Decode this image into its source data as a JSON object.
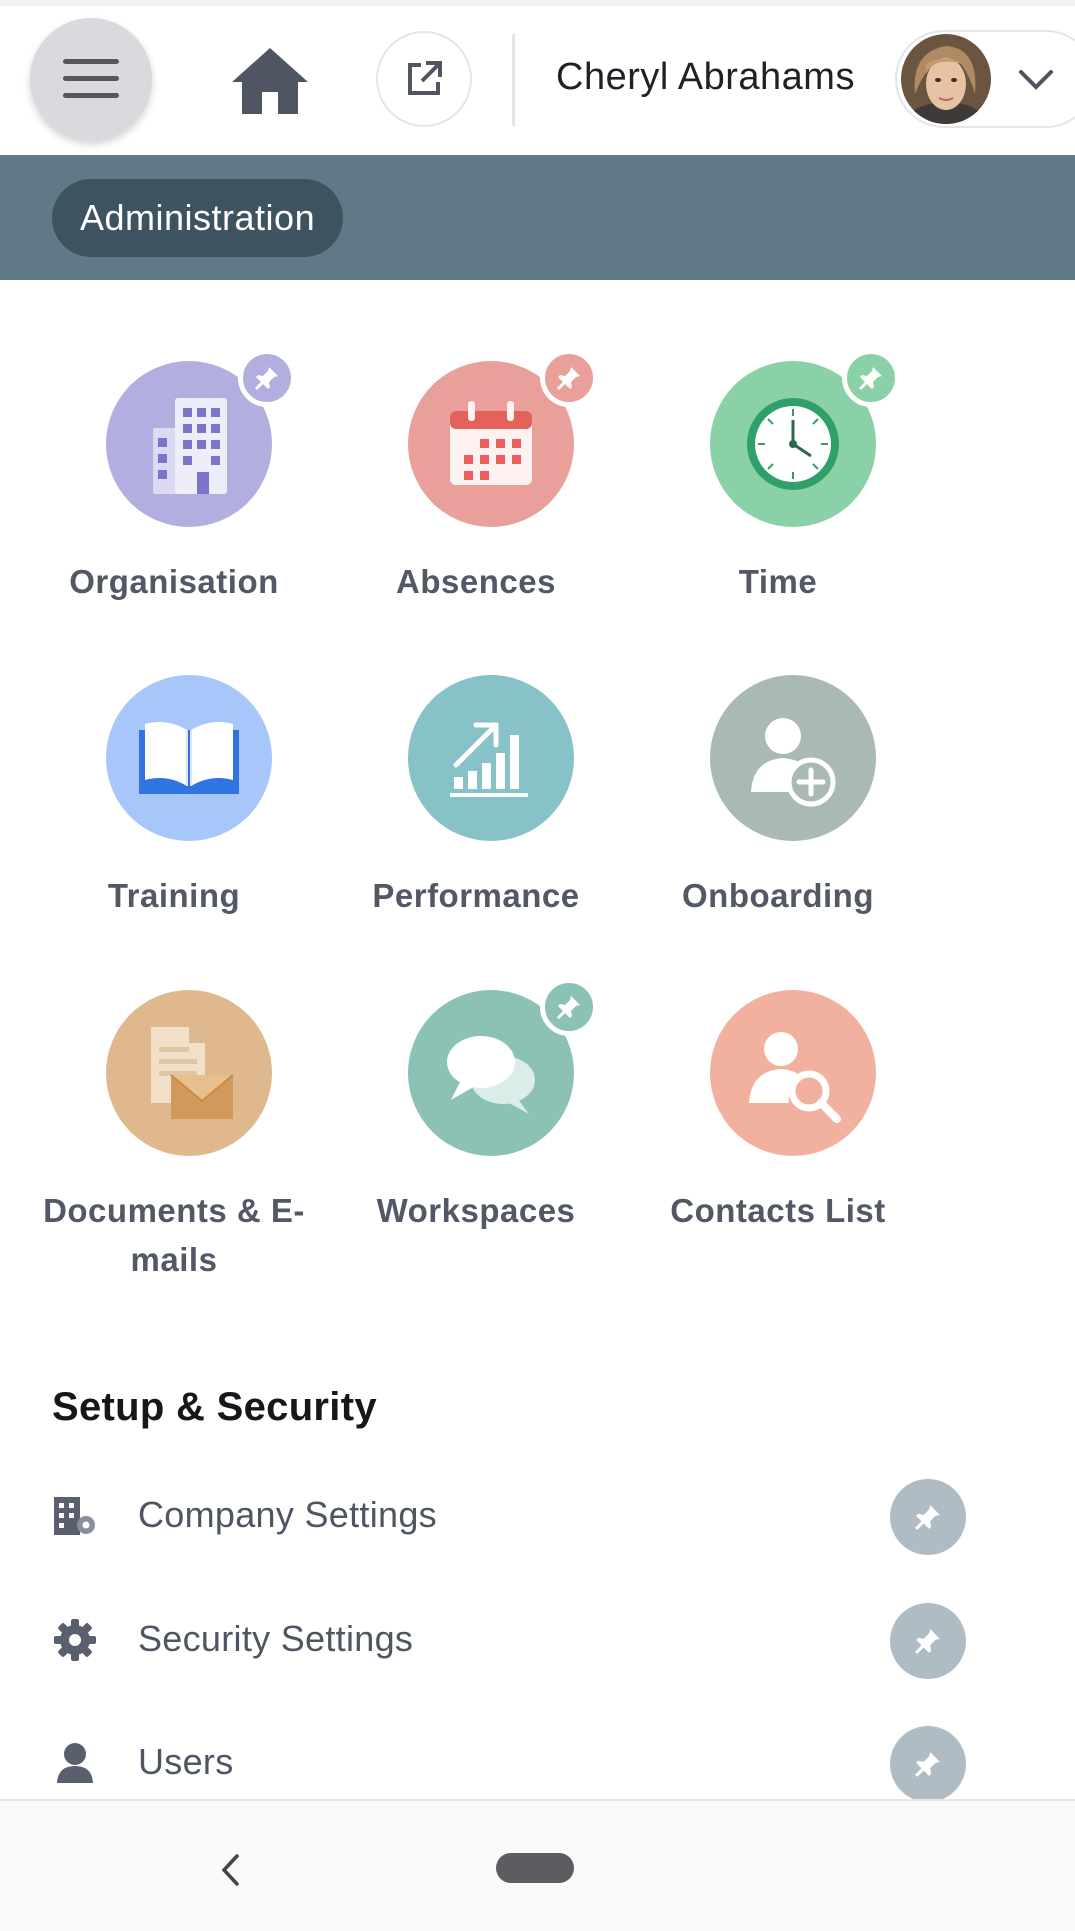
{
  "header": {
    "menu_icon": "hamburger-icon",
    "home_icon": "home-icon",
    "external_icon": "open-external-icon",
    "user_name": "Cheryl Abrahams",
    "avatar_icon": "user-avatar",
    "dropdown_icon": "chevron-down-icon"
  },
  "band": {
    "title": "Administration",
    "color": "#5f7a86",
    "pill_color": "#3d5360"
  },
  "modules": [
    {
      "label": "Organisation",
      "icon": "building-icon",
      "color": "#b2aee0",
      "pinned": true
    },
    {
      "label": "Absences",
      "icon": "calendar-icon",
      "color": "#e9a09b",
      "pinned": true
    },
    {
      "label": "Time",
      "icon": "clock-icon",
      "color": "#8bd1a8",
      "pinned": true
    },
    {
      "label": "Training",
      "icon": "book-icon",
      "color": "#a7c7fb",
      "pinned": false
    },
    {
      "label": "Performance",
      "icon": "growth-chart-icon",
      "color": "#86c2c8",
      "pinned": false
    },
    {
      "label": "Onboarding",
      "icon": "add-person-icon",
      "color": "#a9b9b6",
      "pinned": false
    },
    {
      "label": "Documents & E-mails",
      "label_line1": "Documents & E-",
      "label_line2": "mails",
      "icon": "document-mail-icon",
      "color": "#dfb98d",
      "pinned": false
    },
    {
      "label": "Workspaces",
      "icon": "chat-bubbles-icon",
      "color": "#8cc2b6",
      "pinned": true
    },
    {
      "label": "Contacts List",
      "icon": "person-search-icon",
      "color": "#f2b09e",
      "pinned": false
    }
  ],
  "setup": {
    "title": "Setup & Security",
    "items": [
      {
        "label": "Company Settings",
        "icon": "company-settings-icon"
      },
      {
        "label": "Security Settings",
        "icon": "gear-icon"
      },
      {
        "label": "Users",
        "icon": "user-icon"
      }
    ]
  },
  "system_nav": {
    "back_icon": "back-icon",
    "home_icon": "home-pill"
  }
}
